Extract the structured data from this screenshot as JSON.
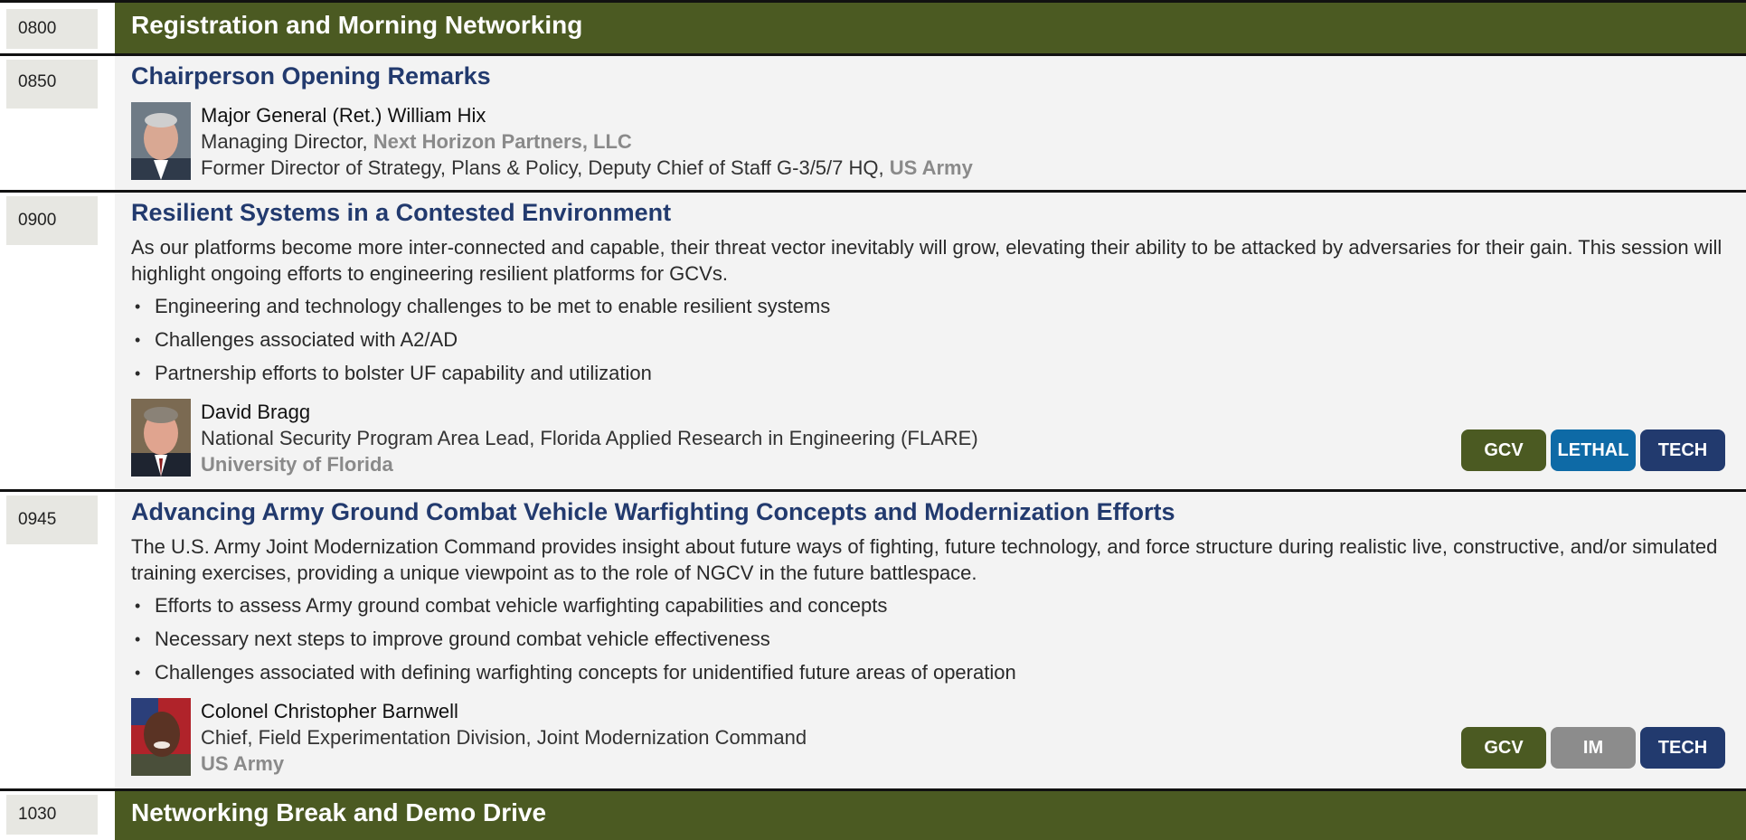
{
  "colors": {
    "banner": "#4b5a22",
    "title": "#223a6e",
    "org": "#8a8a8a",
    "tag_gcv": "#4b5a22",
    "tag_lethal": "#0e6aa6",
    "tag_tech": "#223a6e",
    "tag_im": "#8c8c8c"
  },
  "sessions": [
    {
      "time": "0800",
      "title": "Registration and Morning Networking"
    },
    {
      "time": "0850",
      "title": "Chairperson Opening Remarks",
      "speaker": {
        "photo_icon": "speaker-photo",
        "name": "Major General (Ret.) William Hix",
        "line1_text": "Managing Director, ",
        "line1_org": "Next Horizon Partners, LLC",
        "line2_text": "Former Director of Strategy, Plans & Policy, Deputy Chief of Staff G-3/5/7 HQ, ",
        "line2_org": "US Army"
      }
    },
    {
      "time": "0900",
      "title": "Resilient Systems in a Contested Environment",
      "description": "As our platforms become more inter-connected and capable, their threat vector inevitably will grow, elevating their ability to be attacked by adversaries for their gain. This session will highlight ongoing efforts to engineering resilient platforms for GCVs.",
      "bullets": [
        "Engineering and technology challenges to be met to enable resilient systems",
        "Challenges associated with A2/AD",
        "Partnership efforts to bolster UF capability and utilization"
      ],
      "speaker": {
        "photo_icon": "speaker-photo",
        "name": "David Bragg",
        "role": "National Security Program Area Lead, Florida Applied Research in Engineering (FLARE)",
        "org": "University of Florida"
      },
      "tags": [
        "GCV",
        "LETHAL",
        "TECH"
      ]
    },
    {
      "time": "0945",
      "title": "Advancing Army Ground Combat Vehicle Warfighting Concepts and Modernization Efforts",
      "description": "The U.S. Army Joint Modernization Command provides insight about future ways of fighting, future technology, and force structure during realistic live, constructive, and/or simulated training exercises, providing a unique viewpoint as to the role of NGCV in the future battlespace.",
      "bullets": [
        "Efforts to assess Army ground combat vehicle warfighting capabilities and concepts",
        "Necessary next steps to improve ground combat vehicle effectiveness",
        "Challenges associated with defining warfighting concepts for unidentified future areas of operation"
      ],
      "speaker": {
        "photo_icon": "speaker-photo",
        "name": "Colonel Christopher Barnwell",
        "role": "Chief, Field Experimentation Division, Joint Modernization Command",
        "org": "US Army"
      },
      "tags": [
        "GCV",
        "IM",
        "TECH"
      ]
    },
    {
      "time": "1030",
      "title": "Networking Break and Demo Drive"
    }
  ]
}
